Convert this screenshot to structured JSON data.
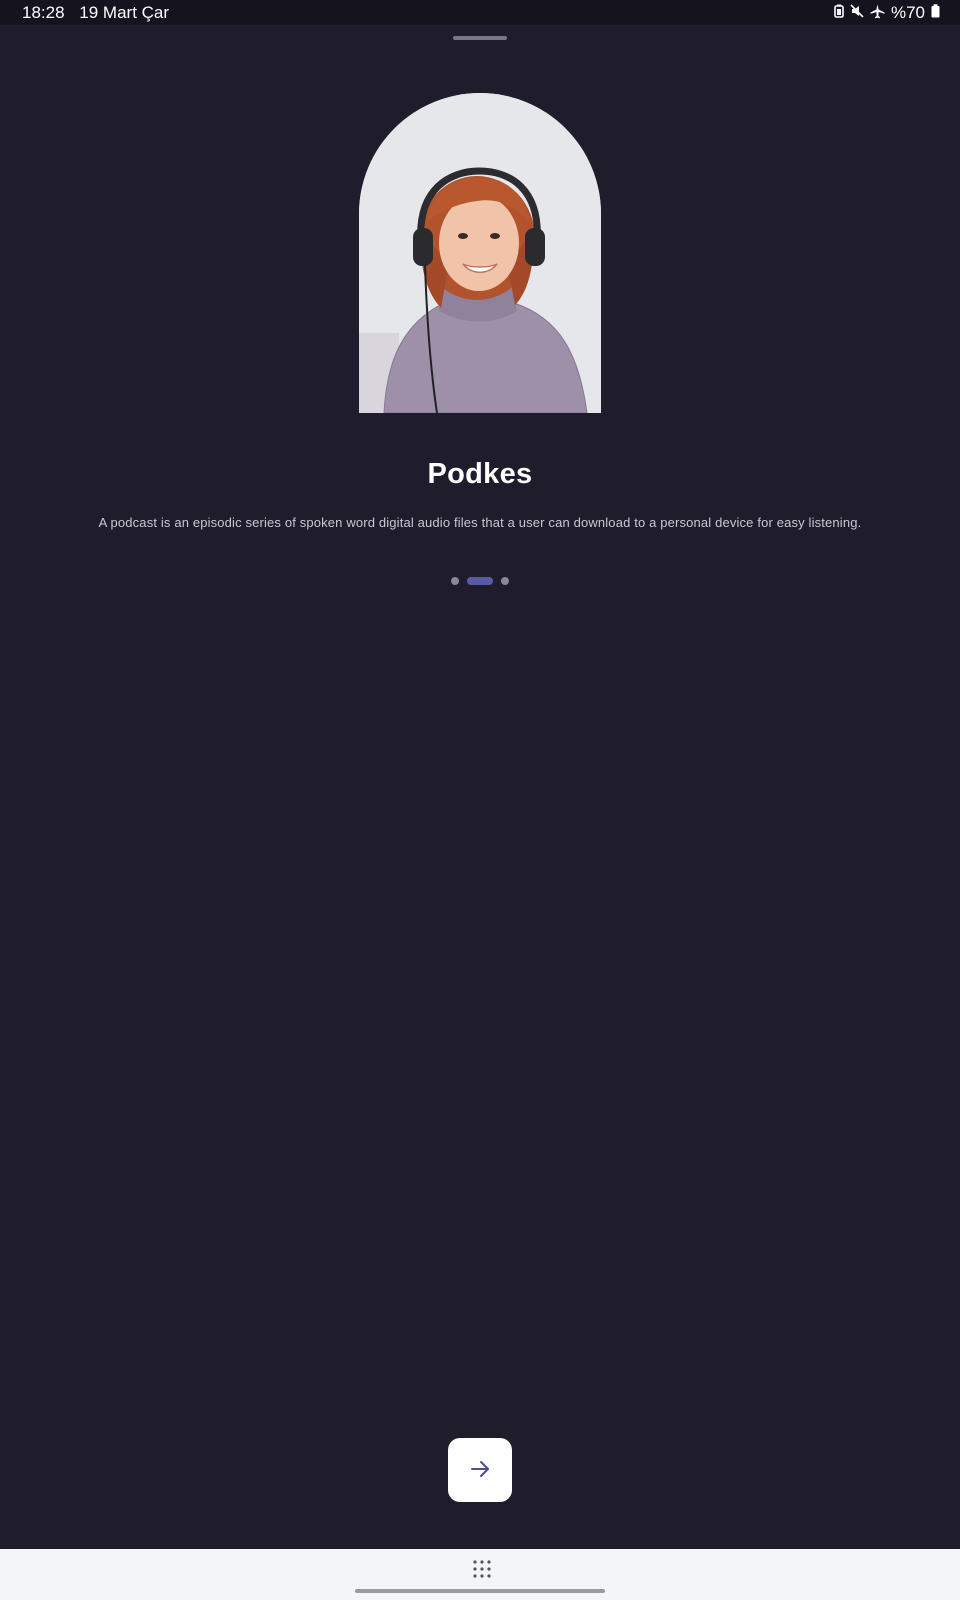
{
  "status_bar": {
    "time": "18:28",
    "date": "19 Mart Çar",
    "battery": "%70",
    "icons": [
      "battery-saver-icon",
      "mute-icon",
      "airplane-icon",
      "battery-icon"
    ]
  },
  "onboarding": {
    "title": "Podkes",
    "description": "A podcast is an episodic series of spoken word digital audio files that a user can download to a personal device for easy listening.",
    "page_count": 3,
    "current_page": 2
  },
  "next_button": {
    "icon": "arrow-right-icon"
  },
  "navigation_bar": {
    "icons": [
      "apps-grid-icon",
      "home-indicator"
    ]
  },
  "colors": {
    "background": "#1f1d2b",
    "accent": "#5a59a6",
    "button": "#ffffff"
  }
}
